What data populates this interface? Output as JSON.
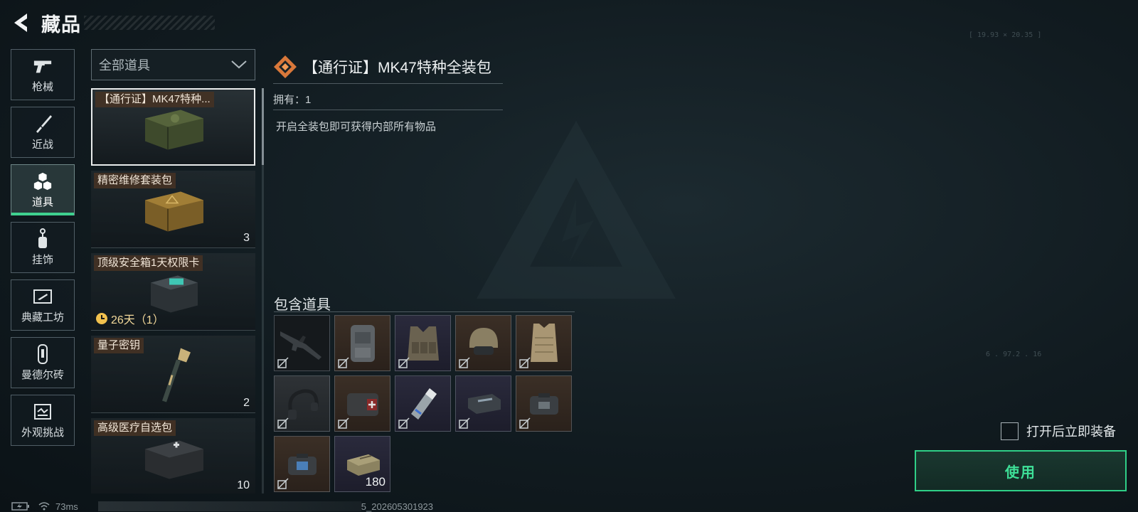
{
  "header": {
    "title": "藏品"
  },
  "categories": [
    {
      "label": "枪械",
      "icon": "gun-icon"
    },
    {
      "label": "近战",
      "icon": "knife-icon"
    },
    {
      "label": "道具",
      "icon": "cubes-icon",
      "active": true
    },
    {
      "label": "挂饰",
      "icon": "charm-icon"
    },
    {
      "label": "典藏工坊",
      "icon": "workshop-icon"
    },
    {
      "label": "曼德尔砖",
      "icon": "brick-icon"
    },
    {
      "label": "外观挑战",
      "icon": "challenge-icon"
    }
  ],
  "filter": {
    "label": "全部道具"
  },
  "items": [
    {
      "name": "【通行证】MK47特种...",
      "count": "",
      "selected": true
    },
    {
      "name": "精密维修套装包",
      "count": "3"
    },
    {
      "name": "顶级安全箱1天权限卡",
      "timer": "26天（1）"
    },
    {
      "name": "量子密钥",
      "count": "2"
    },
    {
      "name": "高级医疗自选包",
      "count": "10"
    }
  ],
  "detail": {
    "name": "【通行证】MK47特种全装包",
    "owned": "拥有：1",
    "description": "开启全装包即可获得内部所有物品",
    "contents_title": "包含道具"
  },
  "contents": [
    {
      "icon": "rifle-icon",
      "rarity": "black",
      "count": ""
    },
    {
      "icon": "backpack-icon",
      "rarity": "brown",
      "count": ""
    },
    {
      "icon": "chest-rig-icon",
      "rarity": "purple",
      "count": ""
    },
    {
      "icon": "helmet-icon",
      "rarity": "brown",
      "count": ""
    },
    {
      "icon": "body-armor-icon",
      "rarity": "brown",
      "count": ""
    },
    {
      "icon": "headset-icon",
      "rarity": "gray",
      "count": ""
    },
    {
      "icon": "medkit-icon",
      "rarity": "brown",
      "count": ""
    },
    {
      "icon": "injector-icon",
      "rarity": "purple",
      "count": ""
    },
    {
      "icon": "repair-kit-icon",
      "rarity": "purple",
      "count": ""
    },
    {
      "icon": "armor-repair-icon",
      "rarity": "brown",
      "count": ""
    },
    {
      "icon": "helmet-repair-icon",
      "rarity": "brown",
      "count": ""
    },
    {
      "icon": "ammo-box-icon",
      "rarity": "purple",
      "count": "180"
    }
  ],
  "actions": {
    "equip_label": "打开后立即装备",
    "use_label": "使用"
  },
  "status": {
    "ping": "73ms",
    "build": "5_202605301923"
  },
  "hud": {
    "coords": "[ 19.93 × 20.35 ]",
    "readout": "6 . 97.2 . 16"
  },
  "colors": {
    "accent": "#3ee098",
    "name_tag": "#46321f"
  }
}
